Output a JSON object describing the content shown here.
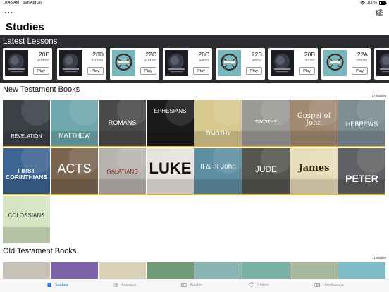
{
  "status_bar": {
    "time": "10:43 AM",
    "date": "Sun Apr 26",
    "battery": "100%"
  },
  "page": {
    "title": "Studies"
  },
  "latest": {
    "title": "Latest Lessons",
    "lessons": [
      {
        "code": "20E",
        "date": "4/23/20",
        "play_label": "Play",
        "thumb": "dark"
      },
      {
        "code": "20D",
        "date": "4/16/20",
        "play_label": "Play",
        "thumb": "dark"
      },
      {
        "code": "22C",
        "date": "4/13/20",
        "play_label": "Play",
        "thumb": "teal"
      },
      {
        "code": "20C",
        "date": "4/8/20",
        "play_label": "Play",
        "thumb": "dark"
      },
      {
        "code": "22B",
        "date": "4/6/20",
        "play_label": "Play",
        "thumb": "teal"
      },
      {
        "code": "20B",
        "date": "4/1/20",
        "play_label": "Play",
        "thumb": "dark"
      },
      {
        "code": "22A",
        "date": "3/30/20",
        "play_label": "Play",
        "thumb": "teal"
      },
      {
        "code": "",
        "date": "",
        "play_label": "",
        "thumb": "dark"
      }
    ]
  },
  "nt": {
    "title": "New Testament Books",
    "count": "17 Studies",
    "books": [
      {
        "name": "REVELATION",
        "bg": "#3c3f46",
        "color": "#ffffff"
      },
      {
        "name": "MATTHEW",
        "bg": "#6ea7ad",
        "color": "#ffffff"
      },
      {
        "name": "ROMANS",
        "bg": "#4a4a48",
        "color": "#ffffff"
      },
      {
        "name": "EPHESIANS",
        "bg": "#1b1b1b",
        "color": "#ffffff"
      },
      {
        "name": "TIMOTHY",
        "bg": "#d8c98f",
        "color": "#ffffff"
      },
      {
        "name": "TIMOTHY",
        "bg": "#9c9a97",
        "color": "#ffffff"
      },
      {
        "name": "Gospel of John",
        "bg": "#a28a72",
        "color": "#ffffff"
      },
      {
        "name": "HEBREWS",
        "bg": "#7c8d94",
        "color": "#ffffff"
      },
      {
        "name": "FIRST CORINTHIANS",
        "bg": "#3d6594",
        "color": "#ffffff"
      },
      {
        "name": "ACTS",
        "bg": "#7b6551",
        "color": "#ffffff"
      },
      {
        "name": "GALATIANS",
        "bg": "#b7b4b0",
        "color": "#8b2b25"
      },
      {
        "name": "LUKE",
        "bg": "#e7e4df",
        "color": "#111111"
      },
      {
        "name": "II & III John",
        "bg": "#5e8fa3",
        "color": "#ffffff"
      },
      {
        "name": "JUDE",
        "bg": "#55564f",
        "color": "#ffffff"
      },
      {
        "name": "James",
        "bg": "#e8ddb9",
        "color": "#3a2b14"
      },
      {
        "name": "PETER",
        "bg": "#606164",
        "color": "#ffffff"
      },
      {
        "name": "COLOSSIANS",
        "bg": "#d6e4c2",
        "color": "#1f2f22"
      }
    ]
  },
  "ot": {
    "title": "Old Testament Books",
    "count": "11 Studies",
    "books": [
      {
        "bg": "#c7c1b8"
      },
      {
        "bg": "#7e62a8"
      },
      {
        "bg": "#d9d2b8"
      },
      {
        "bg": "#6f9a76"
      },
      {
        "bg": "#8bb6b4"
      },
      {
        "bg": "#77b2a2"
      },
      {
        "bg": "#a7b89c"
      },
      {
        "bg": "#7fbac7"
      }
    ]
  },
  "tabs": [
    {
      "label": "Studies",
      "icon": "book-icon",
      "active": true
    },
    {
      "label": "Answers",
      "icon": "list-icon",
      "active": false
    },
    {
      "label": "Articles",
      "icon": "newspaper-icon",
      "active": false
    },
    {
      "label": "Videos",
      "icon": "monitor-icon",
      "active": false
    },
    {
      "label": "Livestreams",
      "icon": "play-box-icon",
      "active": false
    }
  ],
  "colors": {
    "accent": "#1d72e8",
    "band": "#2a2c30",
    "tile_underline": "#e5b63c"
  }
}
